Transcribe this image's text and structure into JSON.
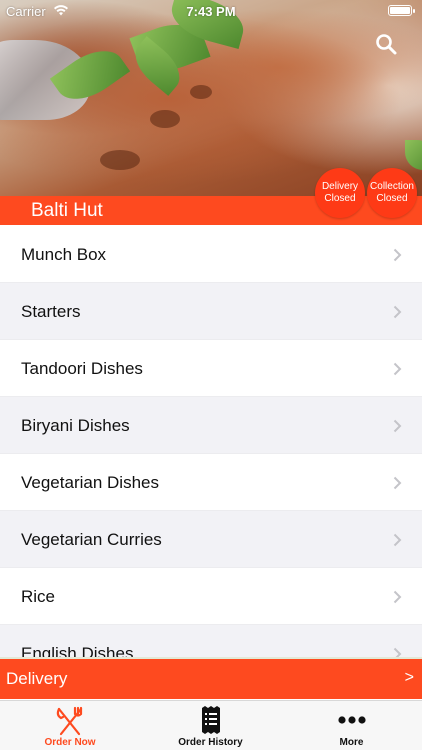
{
  "status_bar": {
    "carrier": "Carrier",
    "time": "7:43 PM"
  },
  "restaurant": {
    "name": "Balti Hut"
  },
  "badges": {
    "delivery": [
      "Delivery",
      "Closed"
    ],
    "collection": [
      "Collection",
      "Closed"
    ]
  },
  "menu": {
    "items": [
      "Munch Box",
      "Starters",
      "Tandoori Dishes",
      "Biryani Dishes",
      "Vegetarian Dishes",
      "Vegetarian Curries",
      "Rice",
      "English Dishes"
    ]
  },
  "delivery_bar": {
    "label": "Delivery",
    "arrow": ">"
  },
  "tabs": [
    {
      "label": "Order Now",
      "icon": "fork-knife-icon"
    },
    {
      "label": "Order History",
      "icon": "receipt-icon"
    },
    {
      "label": "More",
      "icon": "more-dots-icon"
    }
  ],
  "colors": {
    "accent": "#fe4a1f",
    "alt_row": "#f2f2f6"
  }
}
